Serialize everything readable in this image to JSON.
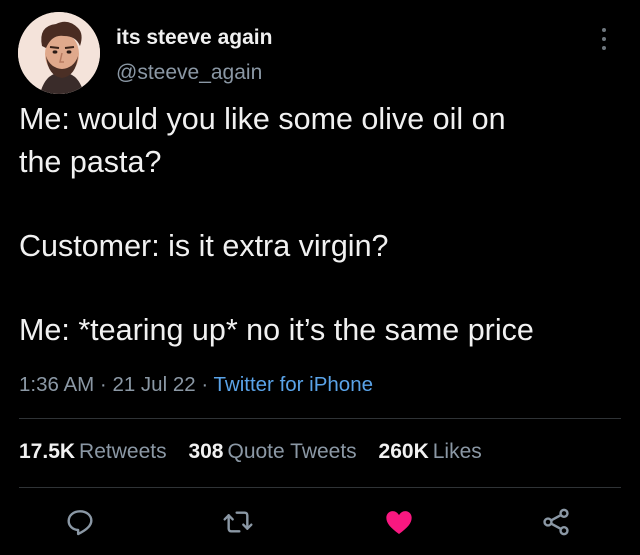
{
  "author": {
    "display_name": "its steeve again",
    "handle": "@steeve_again"
  },
  "tweet": {
    "lines": [
      "Me: would you like some olive oil on",
      "the pasta?",
      "Customer: is it extra virgin?",
      "Me: *tearing up* no it’s the same price"
    ],
    "time": "1:36 AM",
    "sep1": " · ",
    "date": "21 Jul 22",
    "sep2": " · ",
    "source": "Twitter for iPhone"
  },
  "stats": {
    "retweets": {
      "count": "17.5K",
      "label": "Retweets"
    },
    "quotes": {
      "count": "308",
      "label": "Quote Tweets"
    },
    "likes": {
      "count": "260K",
      "label": "Likes"
    }
  },
  "icons": {
    "more": "more-vertical-icon",
    "reply": "reply-icon",
    "retweet": "retweet-icon",
    "like": "heart-filled-icon",
    "share": "share-icon"
  },
  "colors": {
    "background": "#000000",
    "muted": "#8b98a5",
    "link": "#5aa3e8",
    "like": "#f91880"
  }
}
